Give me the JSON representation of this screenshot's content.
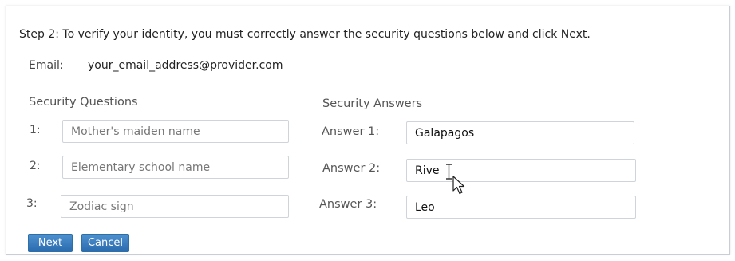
{
  "instructions": "Step 2: To verify your identity, you must correctly answer the security questions below and click Next.",
  "email": {
    "label": "Email:",
    "value": "your_email_address@provider.com"
  },
  "questions": {
    "header": "Security Questions",
    "items": [
      {
        "number": "1:",
        "value": "Mother's maiden name"
      },
      {
        "number": "2:",
        "value": "Elementary school name"
      },
      {
        "number": "3:",
        "value": "Zodiac sign"
      }
    ]
  },
  "answers": {
    "header": "Security Answers",
    "items": [
      {
        "label": "Answer 1:",
        "value": "Galapagos"
      },
      {
        "label": "Answer 2:",
        "value": "Rive"
      },
      {
        "label": "Answer 3:",
        "value": "Leo"
      }
    ]
  },
  "buttons": {
    "next": "Next",
    "cancel": "Cancel"
  },
  "colors": {
    "button": "#3276b1",
    "panel_border": "#c9ced4"
  },
  "icons": [
    "text-cursor-icon",
    "mouse-pointer-icon"
  ]
}
